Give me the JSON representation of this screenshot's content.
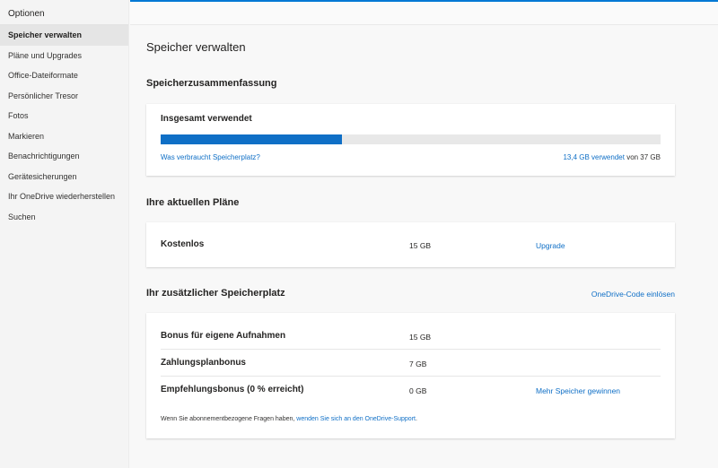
{
  "sidebar": {
    "title": "Optionen",
    "items": [
      {
        "label": "Speicher verwalten",
        "active": true
      },
      {
        "label": "Pläne und Upgrades"
      },
      {
        "label": "Office-Dateiformate"
      },
      {
        "label": "Persönlicher Tresor"
      },
      {
        "label": "Fotos"
      },
      {
        "label": "Markieren"
      },
      {
        "label": "Benachrichtigungen"
      },
      {
        "label": "Gerätesicherungen"
      },
      {
        "label": "Ihr OneDrive wiederherstellen"
      },
      {
        "label": "Suchen"
      }
    ]
  },
  "main": {
    "title": "Speicher verwalten",
    "summary": {
      "heading": "Speicherzusammenfassung",
      "total_label": "Insgesamt verwendet",
      "usage_fraction": 0.362,
      "what_uses_link": "Was verbraucht Speicherplatz?",
      "used_link": "13,4 GB verwendet",
      "used_suffix": "von 37 GB"
    },
    "plans": {
      "heading": "Ihre aktuellen Pläne",
      "plan_name": "Kostenlos",
      "plan_size": "15 GB",
      "upgrade_link": "Upgrade"
    },
    "extra": {
      "heading": "Ihr zusätzlicher Speicherplatz",
      "redeem_link": "OneDrive-Code einlösen",
      "rows": [
        {
          "label": "Bonus für eigene Aufnahmen",
          "amount": "15 GB"
        },
        {
          "label": "Zahlungsplanbonus",
          "amount": "7 GB"
        },
        {
          "label": "Empfehlungsbonus (0 % erreicht)",
          "amount": "0 GB",
          "action": "Mehr Speicher gewinnen"
        }
      ],
      "footer_prefix": "Wenn Sie abonnementbezogene Fragen haben,",
      "footer_link": "wenden Sie sich an den OneDrive-Support",
      "footer_suffix": "."
    }
  },
  "colors": {
    "accent": "#0f6fc6",
    "progress_track": "#e8e8e8",
    "top_border": "#0078d4"
  }
}
